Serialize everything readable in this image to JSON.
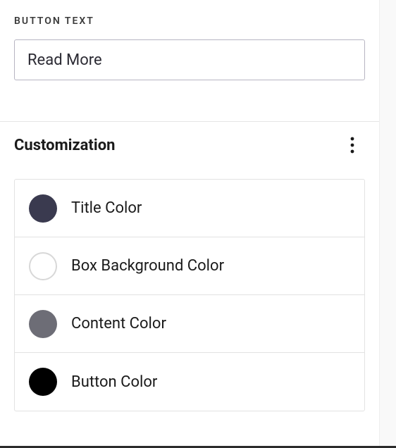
{
  "button_text": {
    "label": "BUTTON TEXT",
    "value": "Read More"
  },
  "customization": {
    "title": "Customization",
    "items": [
      {
        "label": "Title Color",
        "color": "#3a3a4f",
        "hollow": false
      },
      {
        "label": "Box Background Color",
        "color": "#ffffff",
        "hollow": true
      },
      {
        "label": "Content Color",
        "color": "#6d6d76",
        "hollow": false
      },
      {
        "label": "Button Color",
        "color": "#000000",
        "hollow": false
      }
    ]
  }
}
